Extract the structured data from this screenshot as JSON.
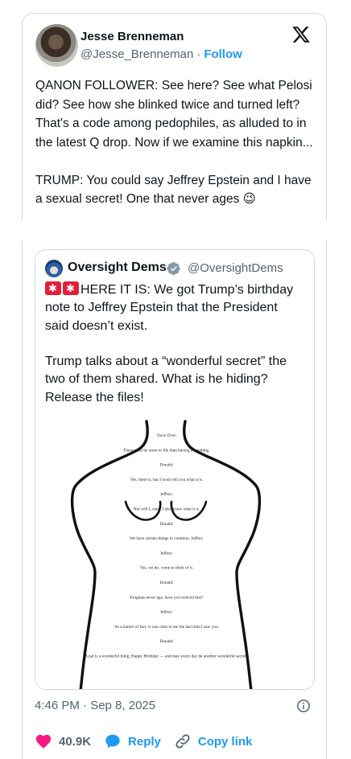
{
  "tweet": {
    "author_name": "Jesse Brenneman",
    "author_handle": "@Jesse_Brenneman",
    "separator": "·",
    "follow_label": "Follow",
    "logo_icon": "x-logo-icon",
    "text": "QANON FOLLOWER: See here? See what Pelosi did? See how she blinked twice and turned left? That's a code among pedophiles, as alluded to in the latest Q drop. Now if we examine this napkin...\n\nTRUMP: You could say Jeffrey Epstein and I have a sexual secret! One that never ages 😉"
  },
  "quoted": {
    "author_name": "Oversight Dems",
    "author_handle": "@OversightDems",
    "verified_icon": "verified-badge-icon",
    "text_emoji_prefix": "🚨🚨",
    "text": "HERE IT IS: We got Trump’s birthday note to Jeffrey Epstein that the President said doesn’t exist.\n\nTrump talks about a “wonderful secret” the two of them shared. What is he hiding? Release the files!",
    "image_lines": [
      "Voice Over:",
      "There must be more to life than having everything.",
      "Donald:",
      "Yes, there is, but I won't tell you what it is.",
      "Jeffrey:",
      "Nor will I, since I also know what it is.",
      "Donald:",
      "We have certain things in common, Jeffrey.",
      "Jeffrey:",
      "Yes, we do, come to think of it.",
      "Donald:",
      "Enigmas never age, have you noticed that?",
      "Jeffrey:",
      "As a matter of fact, it was clear to me the last time I saw you.",
      "Donald:",
      "A pal is a wonderful thing. Happy Birthday — and may every day be another wonderful secret."
    ]
  },
  "footer": {
    "timestamp": "4:46 PM · Sep 8, 2025",
    "like_count": "40.9K",
    "reply_label": "Reply",
    "copy_label": "Copy link"
  },
  "colors": {
    "accent": "#1d9bf0",
    "like": "#f91880",
    "muted": "#536471",
    "border": "#cfd9de"
  }
}
